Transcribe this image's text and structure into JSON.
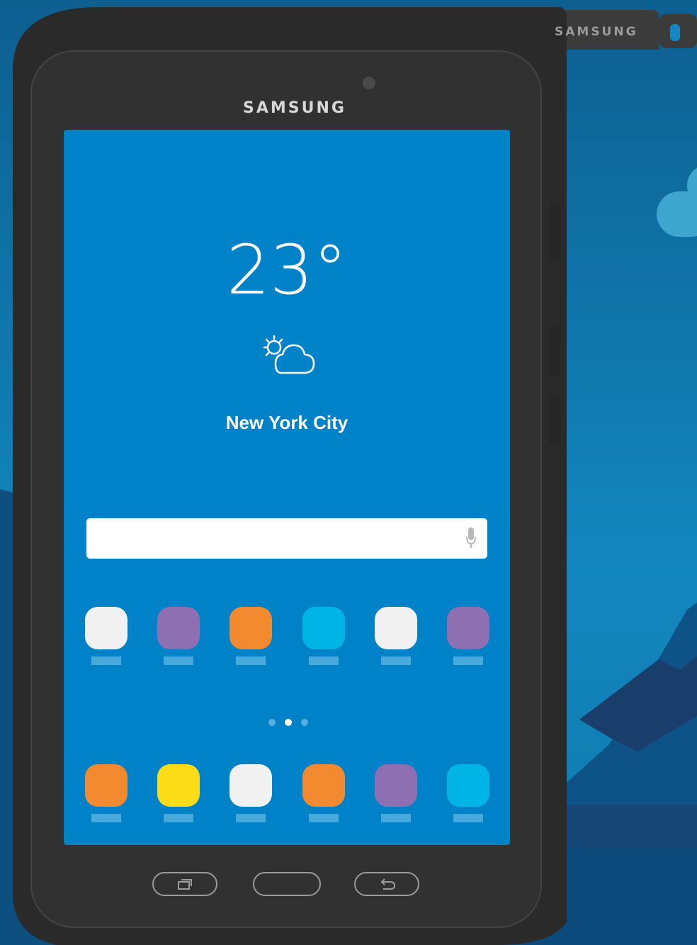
{
  "device": {
    "brand_top": "SAMSUNG",
    "brand_stylus": "SAMSUNG"
  },
  "weather": {
    "temperature": "23°",
    "icon": "partly-cloudy-icon",
    "city": "New York City"
  },
  "search": {
    "value": "",
    "placeholder": "",
    "mic_icon": "microphone-icon"
  },
  "apps_row1": [
    {
      "color": "#f1f1f1"
    },
    {
      "color": "#8e6fb2"
    },
    {
      "color": "#f48a30"
    },
    {
      "color": "#00b4e6"
    },
    {
      "color": "#f1f1f1"
    },
    {
      "color": "#8e6fb2"
    }
  ],
  "page_indicator": {
    "pages": 3,
    "current": 2
  },
  "apps_dock": [
    {
      "color": "#f48a30"
    },
    {
      "color": "#fcdc16"
    },
    {
      "color": "#f1f1f1"
    },
    {
      "color": "#f48a30"
    },
    {
      "color": "#8e6fb2"
    },
    {
      "color": "#00b4e6"
    }
  ],
  "nav": {
    "recents_icon": "recent-apps-icon",
    "home_icon": "home-button",
    "back_icon": "back-arrow-icon"
  },
  "colors": {
    "screen": "#0082c8",
    "bezel": "#2a2a2a",
    "background": "#0c6a9a"
  }
}
